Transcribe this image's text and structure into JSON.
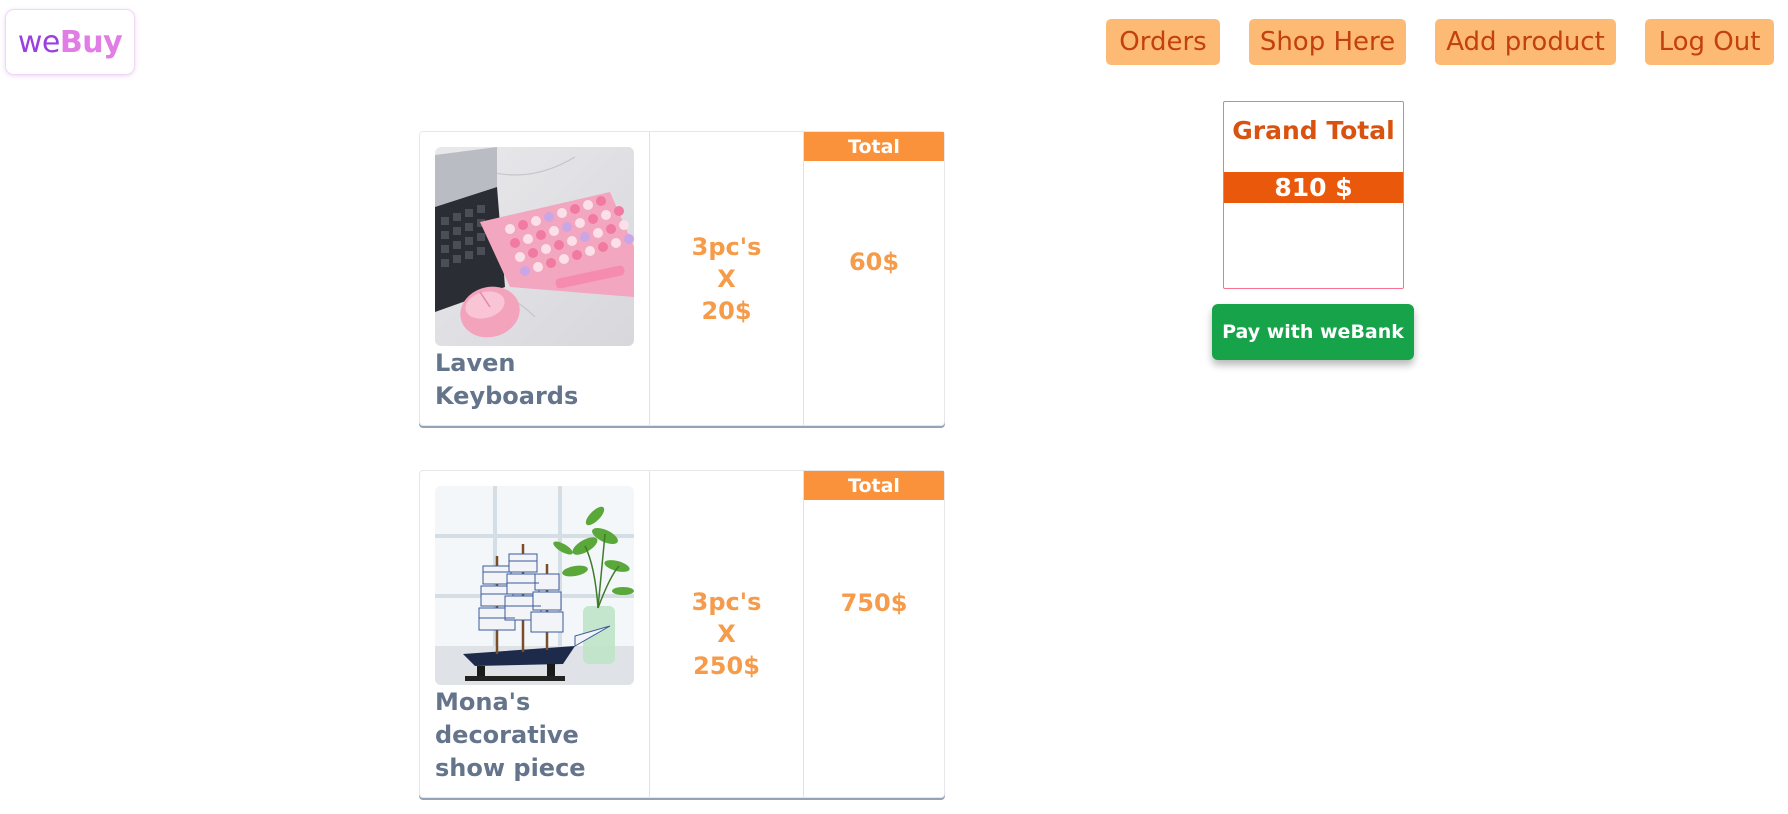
{
  "logo": {
    "part1": "we",
    "part2": "Buy"
  },
  "nav": {
    "orders": "Orders",
    "shop": "Shop Here",
    "add_product": "Add product",
    "logout": "Log Out"
  },
  "cart": {
    "items": [
      {
        "name": "Laven Keyboards",
        "qty": "3pc's",
        "times": "X",
        "unit_price": "20$",
        "total_label": "Total",
        "total": "60$"
      },
      {
        "name": "Mona's decorative show piece",
        "qty": "3pc's",
        "times": "X",
        "unit_price": "250$",
        "total_label": "Total",
        "total": "750$"
      }
    ]
  },
  "summary": {
    "title": "Grand Total",
    "amount": "810 $",
    "pay_button": "Pay with weBank"
  },
  "colors": {
    "nav_bg": "#fdba74",
    "nav_text": "#c2410c",
    "accent_orange": "#f9923a",
    "grand_total_bg": "#ea580c",
    "pay_green": "#16a34a",
    "logo_purple": "#9b3fe0",
    "logo_pink": "#e17ee6"
  }
}
